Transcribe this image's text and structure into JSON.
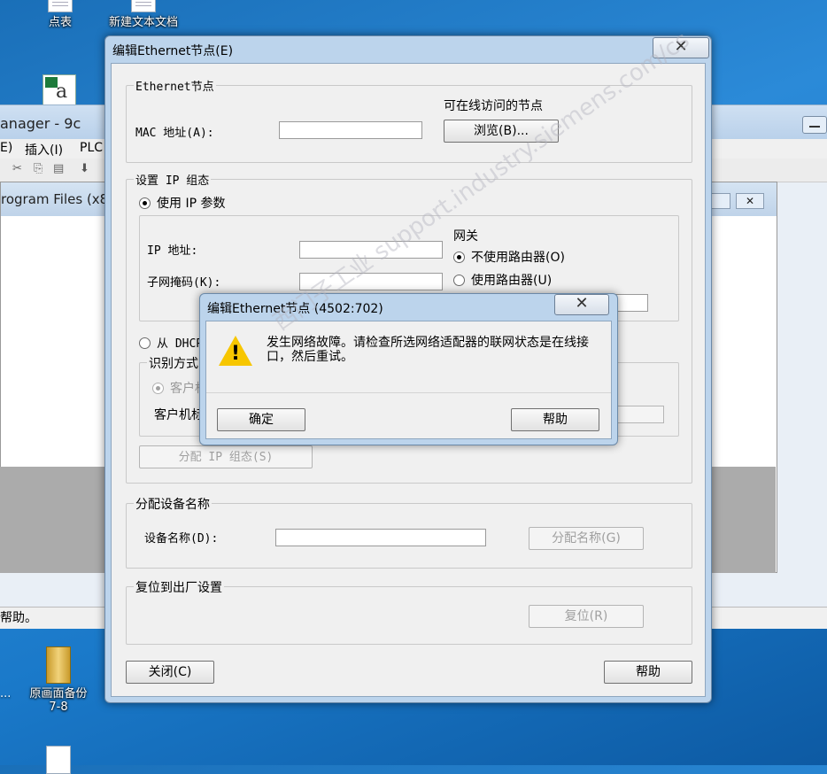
{
  "desktop": {
    "icons": [
      {
        "label": "点表"
      },
      {
        "label": "新建文本文档"
      },
      {
        "label": "原画面备份\n7-8"
      },
      {
        "label": "..."
      }
    ]
  },
  "bg_app": {
    "title": "anager - 9c",
    "menu": [
      "E)",
      "插入(I)",
      "PLC"
    ],
    "inner_title": "rogram Files (x86",
    "status": "帮助。"
  },
  "dialog": {
    "title": "编辑Ethernet节点(E)",
    "close_glyph": "✕",
    "ethernet_group": {
      "label": "Ethernet节点",
      "online_label": "可在线访问的节点",
      "mac_label": "MAC 地址(A):",
      "mac_value": "",
      "browse_button": "浏览(B)..."
    },
    "ip_group": {
      "label": "设置 IP 组态",
      "use_ip_params": "使用 IP 参数",
      "ip_label": "IP 地址:",
      "ip_value": "",
      "subnet_label": "子网掩码(K):",
      "subnet_value": "",
      "gateway_label": "网关",
      "no_router": "不使用路由器(O)",
      "use_router": "使用路由器(U)",
      "from_dhcp": "从 DHCP",
      "identify_label": "识别方式",
      "client": "客户机",
      "client_id_label": "客户机标",
      "assign_button": "分配 IP 组态(S)"
    },
    "device_group": {
      "label": "分配设备名称",
      "name_label": "设备名称(D):",
      "name_value": "",
      "assign_button": "分配名称(G)"
    },
    "reset_group": {
      "label": "复位到出厂设置",
      "reset_button": "复位(R)"
    },
    "close_button": "关闭(C)",
    "help_button": "帮助"
  },
  "error_dialog": {
    "title": "编辑Ethernet节点  (4502:702)",
    "close_glyph": "✕",
    "message": "发生网络故障。请检查所选网络适配器的联网状态是在线接口，然后重试。",
    "ok_button": "确定",
    "help_button": "帮助"
  },
  "watermark": "西门子工业 support.industry.siemens.com/cs",
  "colors": {
    "desktop": "#1a79c9",
    "frame": "#bcd4ec",
    "face": "#f0f0f0",
    "warning": "#f7c600"
  }
}
